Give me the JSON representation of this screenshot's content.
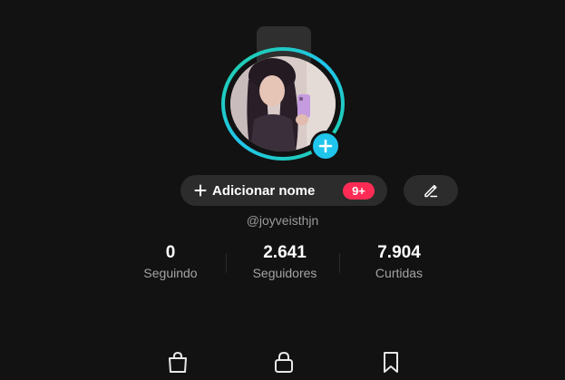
{
  "profile": {
    "note_text": ".",
    "add_name_label": "Adicionar nome",
    "notification_badge": "9+",
    "username": "@joyveisthjn"
  },
  "stats": [
    {
      "value": "0",
      "label": "Seguindo"
    },
    {
      "value": "2.641",
      "label": "Seguidores"
    },
    {
      "value": "7.904",
      "label": "Curtidas"
    }
  ],
  "tabs": [
    {
      "icon": "shopping-bag-icon"
    },
    {
      "icon": "lock-icon"
    },
    {
      "icon": "bookmark-icon"
    }
  ],
  "icons": {
    "avatar_add": "plus-icon",
    "name_add": "plus-icon",
    "edit": "pencil-icon"
  },
  "colors": {
    "background": "#121212",
    "ring_start": "#20c5ec",
    "ring_end": "#1fd0a3",
    "add_badge": "#20c5ec",
    "notification_badge": "#fe2c55",
    "pill_background": "#2c2c2c"
  }
}
